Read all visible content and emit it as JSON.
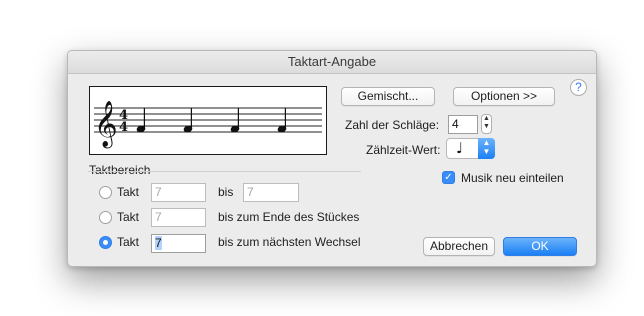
{
  "window": {
    "title": "Taktart-Angabe"
  },
  "buttons": {
    "gemischt": "Gemischt...",
    "optionen": "Optionen >>",
    "help": "?",
    "abbrechen": "Abbrechen",
    "ok": "OK"
  },
  "beats": {
    "label": "Zahl der Schläge:",
    "value": "4"
  },
  "count_value": {
    "label": "Zählzeit-Wert:",
    "symbol": "♩"
  },
  "rebar": {
    "label": "Musik neu einteilen",
    "checked": true
  },
  "measure_range": {
    "heading": "Taktbereich",
    "rows": [
      {
        "radio_label": "Takt",
        "from": "7",
        "middle": "bis",
        "to": "7",
        "selected": false
      },
      {
        "radio_label": "Takt",
        "from": "7",
        "middle": "bis zum Ende des Stückes",
        "selected": false
      },
      {
        "radio_label": "Takt",
        "from": "7",
        "middle": "bis zum nächsten Wechsel",
        "selected": true
      }
    ]
  },
  "preview": {
    "clef": "𝄞",
    "time_top": "4",
    "time_bottom": "4",
    "notes": [
      "♩",
      "♩",
      "♩",
      "♩"
    ]
  },
  "colors": {
    "accent": "#1b7ff5",
    "dialog_bg": "#ececec"
  }
}
